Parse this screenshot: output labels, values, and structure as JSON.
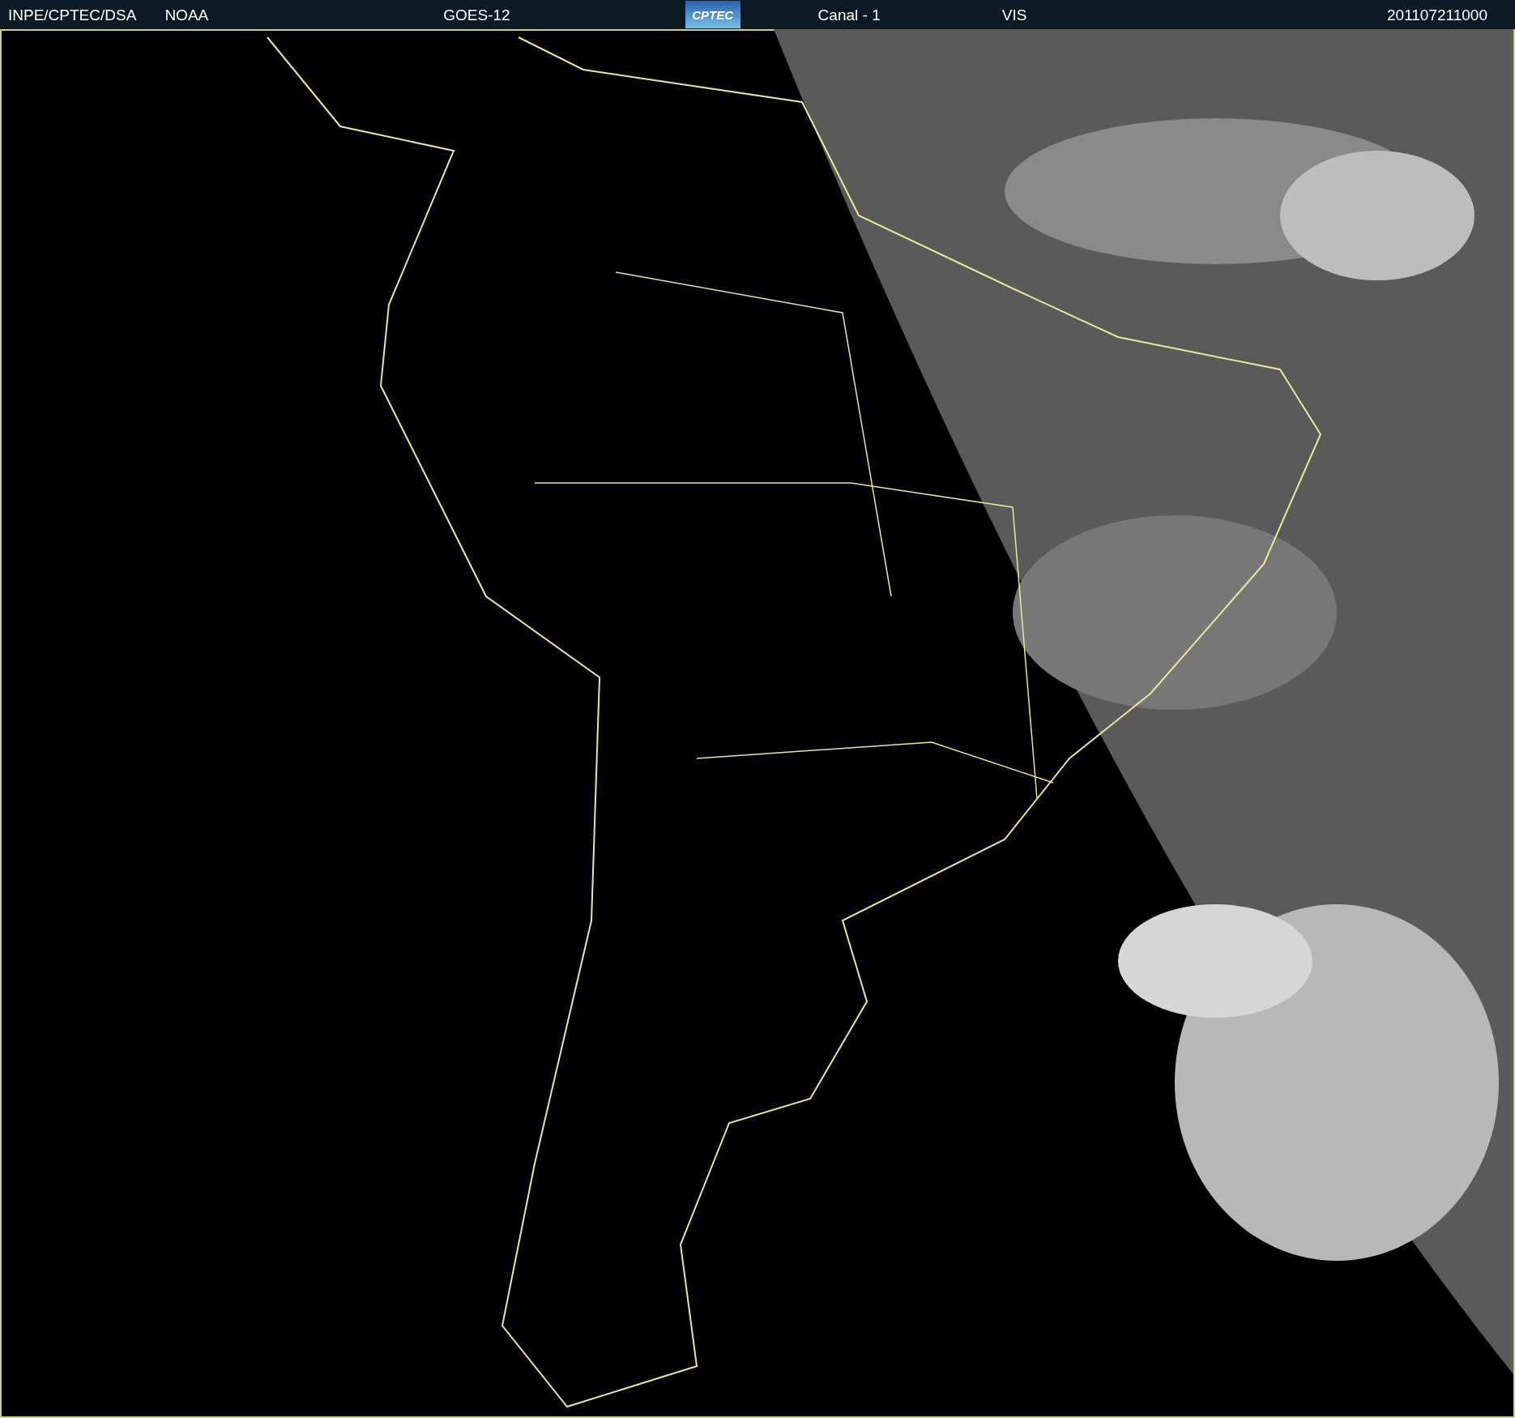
{
  "header": {
    "source": "INPE/CPTEC/DSA",
    "agency": "NOAA",
    "satellite": "GOES-12",
    "logo": "CPTEC",
    "channel": "Canal - 1",
    "band": "VIS",
    "timestamp": "201107211000"
  }
}
